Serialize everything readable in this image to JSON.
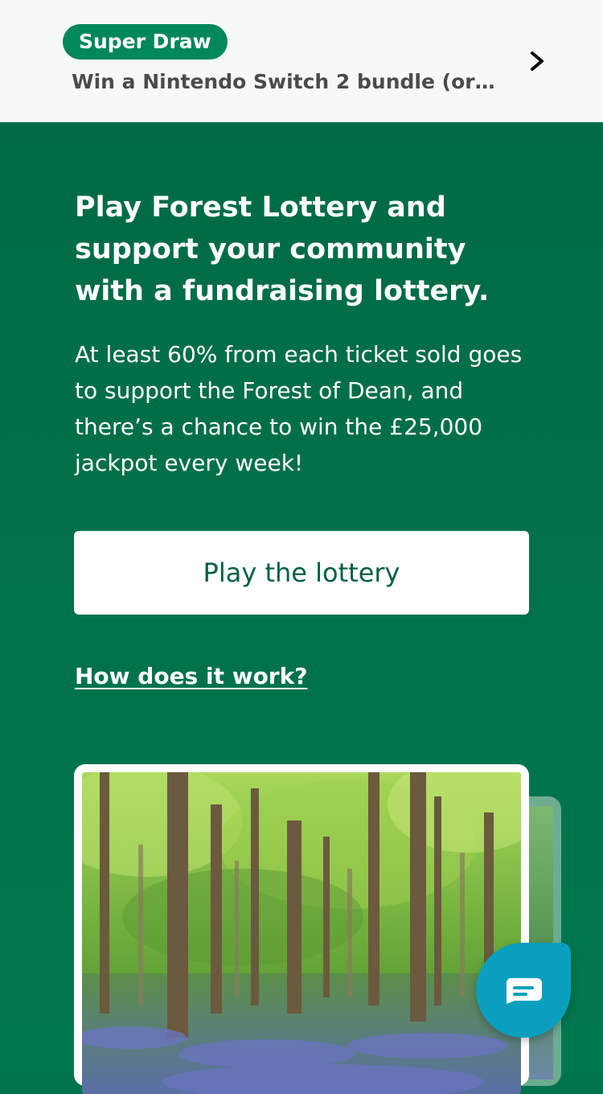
{
  "banner": {
    "badge": "Super Draw",
    "text": "Win a Nintendo Switch 2 bundle (or c...",
    "chevron_icon": "chevron-right-icon"
  },
  "hero": {
    "headline": "Play Forest Lottery and support your community with a fundraising lottery.",
    "subtext": "At least 60% from each ticket sold goes to support the Forest of Dean, and there’s a chance to win the £25,000 jackpot every week!",
    "cta_label": "Play the lottery",
    "how_link": "How does it work?"
  },
  "chat": {
    "icon": "chat-bubble-icon"
  },
  "colors": {
    "brand_green": "#00734d",
    "badge_green": "#00875a",
    "cta_text": "#00613f",
    "chat_teal": "#0aa0bd"
  }
}
